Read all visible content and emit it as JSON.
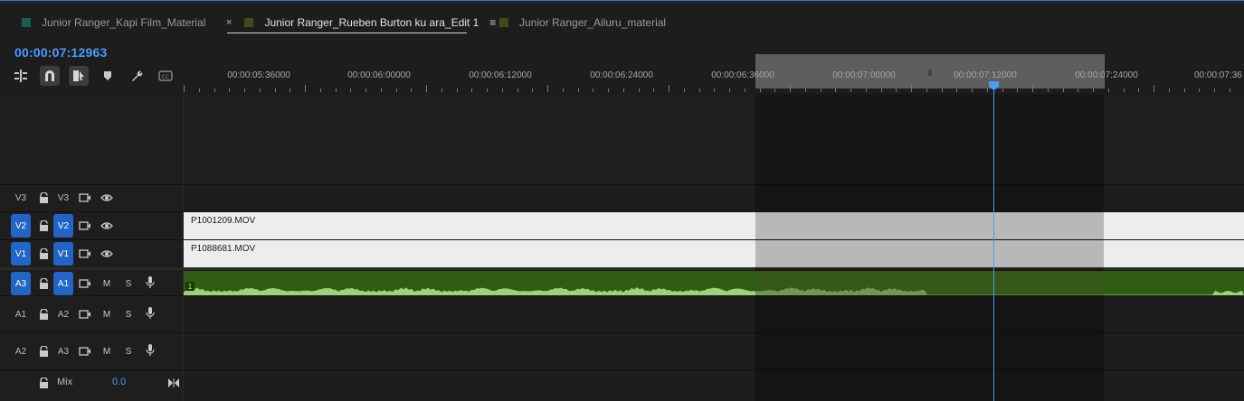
{
  "tabs": [
    {
      "label": "Junior Ranger_Kapi Film_Material",
      "color": "#1b5e58",
      "active": false
    },
    {
      "label": "Junior Ranger_Rueben Burton ku ara_Edit 1",
      "color": "#3e4d14",
      "active": true,
      "close": "×",
      "menu": "≡"
    },
    {
      "label": "Junior Ranger_Ailuru_material",
      "color": "#3e4d14",
      "active": false
    }
  ],
  "timecode": "00:00:07:12963",
  "tools": [
    "insert-track-icon",
    "snap-magnet-icon",
    "linked-selection-icon",
    "add-marker-icon",
    "wrench-settings-icon",
    "captions-icon"
  ],
  "ruler": {
    "labels": [
      "00:00:05:36000",
      "00:00:06:00000",
      "00:00:06:12000",
      "00:00:06:24000",
      "00:00:06:36000",
      "00:00:07:00000",
      "00:00:07:12000",
      "00:00:07:24000",
      "00:00:07:36"
    ],
    "work_area_grip": "⦀"
  },
  "tracks": {
    "V3": {
      "source": "V3",
      "target": "V3"
    },
    "V2": {
      "source": "V2",
      "target": "V2",
      "clip": "P1001209.MOV"
    },
    "V1": {
      "source": "V1",
      "target": "V1",
      "clip": "P1088681.MOV"
    },
    "A3": {
      "source": "A3",
      "target": "A1",
      "m": "M",
      "s": "S",
      "clip_badge": "1"
    },
    "A1": {
      "source": "A1",
      "target": "A2",
      "m": "M",
      "s": "S"
    },
    "A2": {
      "source": "A2",
      "target": "A3",
      "m": "M",
      "s": "S"
    }
  },
  "mix": {
    "label": "Mix",
    "value": "0.0"
  },
  "colors": {
    "accent": "#4a9bff",
    "target": "#2165c7",
    "audio": "#2f5e12",
    "audio_wave": "#9fd07a"
  }
}
